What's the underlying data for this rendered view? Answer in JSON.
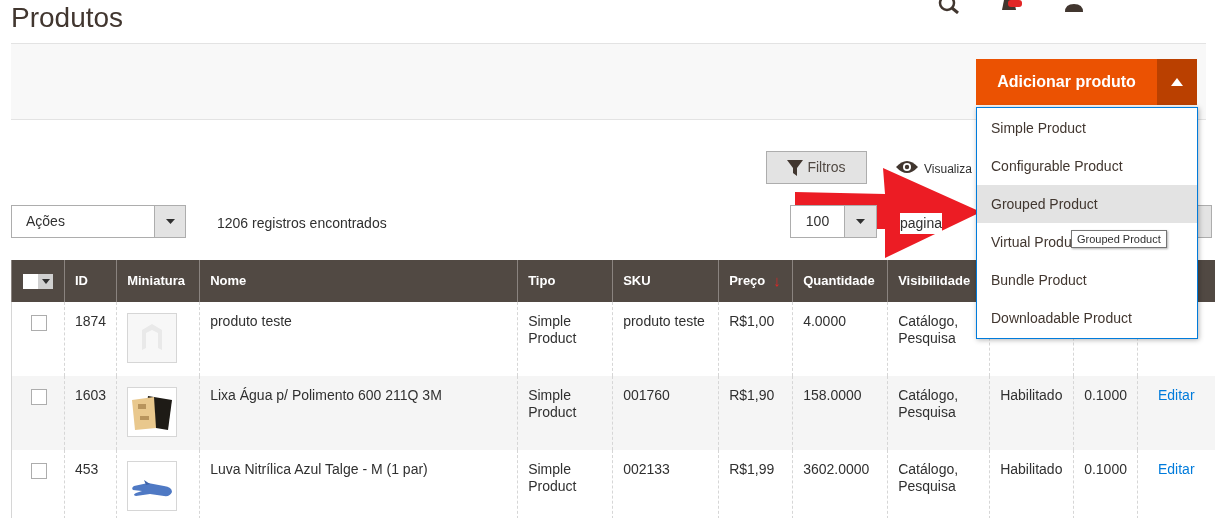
{
  "page_title": "Produtos",
  "add_button": {
    "label": "Adicionar produto",
    "expanded": true
  },
  "add_menu": [
    {
      "label": "Simple Product",
      "selected": false
    },
    {
      "label": "Configurable Product",
      "selected": false
    },
    {
      "label": "Grouped Product",
      "selected": true
    },
    {
      "label": "Virtual Produ",
      "selected": false
    },
    {
      "label": "Bundle Product",
      "selected": false
    },
    {
      "label": "Downloadable Product",
      "selected": false
    }
  ],
  "tooltip": "Grouped Product",
  "filters_button": "Filtros",
  "view_label": "Visualiza",
  "actions_select": "Ações",
  "records_found": "1206 registros encontrados",
  "per_page": {
    "value": "100",
    "label": "pagina"
  },
  "table": {
    "columns": [
      {
        "label": "ID"
      },
      {
        "label": "Miniatura"
      },
      {
        "label": "Nome"
      },
      {
        "label": "Tipo"
      },
      {
        "label": "SKU"
      },
      {
        "label": "Preço",
        "sort": "↓"
      },
      {
        "label": "Quantidade"
      },
      {
        "label": "Visibilidade"
      }
    ],
    "rows": [
      {
        "checked": false,
        "cells": [
          "1874",
          {
            "kind": "picture"
          },
          "produto teste",
          "Simple Product",
          "produto teste",
          "R$1,00",
          "4.0000",
          "Catálogo, Pesquisa"
        ]
      },
      {
        "checked": false,
        "cells": [
          "1603",
          {
            "kind": "picture"
          },
          "Lixa Água p/ Polimento 600 211Q 3M",
          "Simple Product",
          "001760",
          "R$1,90",
          "158.0000",
          "Catálogo, Pesquisa",
          "Habilitado",
          "0.1000"
        ],
        "action": "Editar"
      },
      {
        "checked": false,
        "cells": [
          "453",
          {
            "kind": "picture"
          },
          "Luva Nitrílica Azul Talge - M (1 par)",
          "Simple Product",
          "002133",
          "R$1,99",
          "3602.0000",
          "Catálogo, Pesquisa",
          "Habilitado",
          "0.1000"
        ],
        "action": "Editar"
      }
    ]
  }
}
